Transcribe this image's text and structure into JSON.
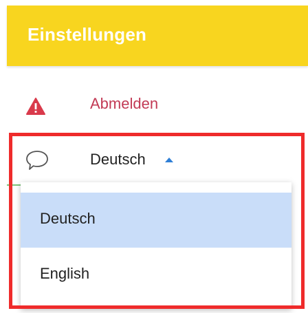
{
  "header": {
    "title": "Einstellungen"
  },
  "menu": {
    "logout": {
      "label": "Abmelden",
      "icon": "warning-icon"
    },
    "language": {
      "icon": "chat-bubble-icon",
      "current_value": "Deutsch",
      "options": [
        "Deutsch",
        "English"
      ],
      "selected_index": 0
    }
  },
  "colors": {
    "header_bg": "#f8d51f",
    "header_text": "#ffffff",
    "logout_text": "#c23a55",
    "selected_option_bg": "#c9ddf9",
    "caret": "#2f7fd6",
    "highlight_frame": "#ef2b2b"
  }
}
